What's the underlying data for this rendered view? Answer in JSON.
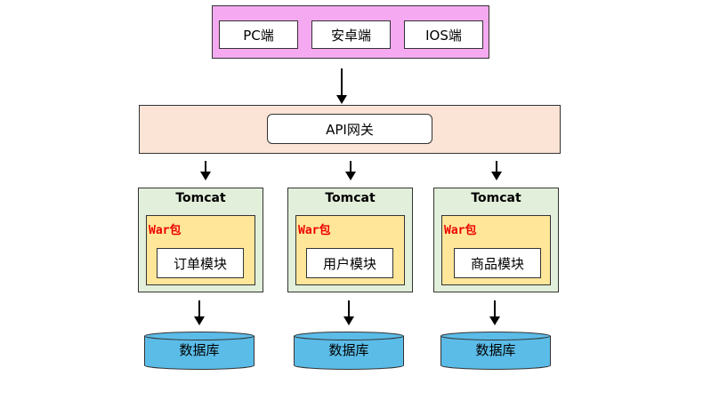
{
  "clients": [
    "PC端",
    "安卓端",
    "IOS端"
  ],
  "gateway": "API网关",
  "services": [
    {
      "container": "Tomcat",
      "package": "War包",
      "module": "订单模块",
      "database": "数据库"
    },
    {
      "container": "Tomcat",
      "package": "War包",
      "module": "用户模块",
      "database": "数据库"
    },
    {
      "container": "Tomcat",
      "package": "War包",
      "module": "商品模块",
      "database": "数据库"
    }
  ],
  "colors": {
    "client_bar": "#f5a9f0",
    "gateway_bar": "#fbe3d6",
    "tomcat_bg": "#e2efda",
    "war_bg": "#ffe699",
    "war_label": "#ee0000",
    "database": "#5bbce8"
  }
}
